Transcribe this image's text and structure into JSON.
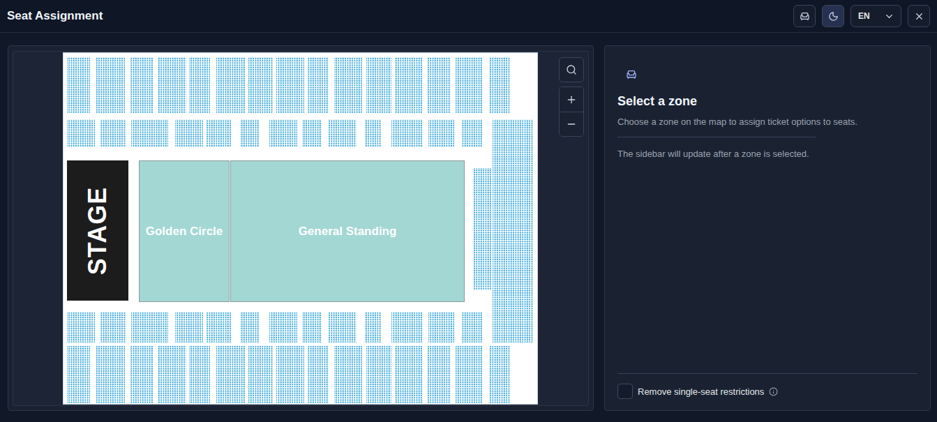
{
  "header": {
    "title": "Seat Assignment",
    "language": "EN",
    "dark_mode": true
  },
  "map": {
    "zones": [
      {
        "label": "STAGE",
        "kind": "stage"
      },
      {
        "label": "Golden Circle",
        "kind": "standing"
      },
      {
        "label": "General Standing",
        "kind": "standing"
      }
    ]
  },
  "sidebar": {
    "heading": "Select a zone",
    "subtitle": "Choose a zone on the map to assign ticket options to seats.",
    "hint": "The sidebar will update after a zone is selected.",
    "option": {
      "label": "Remove single-seat restrictions",
      "checked": false
    }
  }
}
